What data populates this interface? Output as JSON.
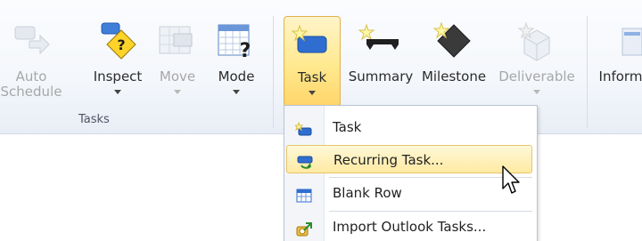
{
  "ribbon": {
    "group_label": "Tasks",
    "auto_schedule": {
      "line1": "Auto",
      "line2": "Schedule"
    },
    "inspect_label": "Inspect",
    "move_label": "Move",
    "mode_label": "Mode",
    "task_label": "Task",
    "summary_label": "Summary",
    "milestone_label": "Milestone",
    "deliverable_label": "Deliverable",
    "information_label": "Inform"
  },
  "task_menu": {
    "items": [
      {
        "label": "Task",
        "icon": "task-icon"
      },
      {
        "label": "Recurring Task...",
        "icon": "recurring-task-icon"
      },
      {
        "label": "Blank Row",
        "icon": "blank-row-icon"
      },
      {
        "label": "Import Outlook Tasks...",
        "icon": "import-outlook-tasks-icon"
      }
    ],
    "highlighted_item": "Recurring Task..."
  },
  "colors": {
    "accent_hover": "#ffeaa2",
    "selected_button": "#ffe98f",
    "ribbon_bg": "#f4f7fb"
  }
}
